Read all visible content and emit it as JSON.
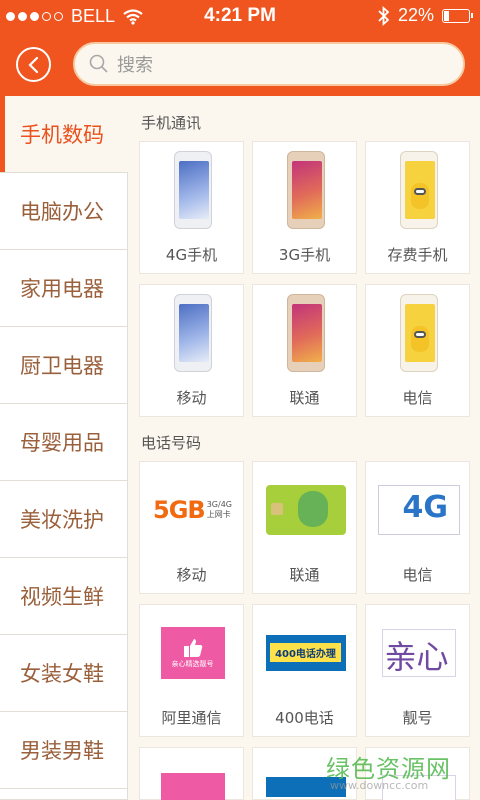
{
  "status_bar": {
    "carrier": "BELL",
    "time": "4:21 PM",
    "battery_text": "22%",
    "battery_level": 0.22,
    "signal_bars": 3
  },
  "header": {
    "search_placeholder": "搜索"
  },
  "sidebar": {
    "items": [
      {
        "label": "手机数码"
      },
      {
        "label": "电脑办公"
      },
      {
        "label": "家用电器"
      },
      {
        "label": "厨卫电器"
      },
      {
        "label": "母婴用品"
      },
      {
        "label": "美妆洗护"
      },
      {
        "label": "视频生鲜"
      },
      {
        "label": "女装女鞋"
      },
      {
        "label": "男装男鞋"
      }
    ]
  },
  "sections": [
    {
      "title": "手机通讯",
      "items": [
        {
          "label": "4G手机"
        },
        {
          "label": "3G手机"
        },
        {
          "label": "存费手机"
        },
        {
          "label": "移动"
        },
        {
          "label": "联通"
        },
        {
          "label": "电信"
        }
      ]
    },
    {
      "title": "电话号码",
      "items": [
        {
          "label": "移动"
        },
        {
          "label": "联通"
        },
        {
          "label": "电信"
        },
        {
          "label": "阿里通信"
        },
        {
          "label": "400电话"
        },
        {
          "label": "靓号"
        }
      ]
    }
  ],
  "ads": {
    "fiveg_main": "5GB",
    "fiveg_top": "3G/4G",
    "fiveg_sub": "上网卡",
    "fourg": "4G",
    "pink_text": "亲心精选靓号",
    "blue_text": "400电话办理",
    "xin_text": "亲心"
  },
  "watermark": {
    "text": "绿色资源网",
    "url": "www.downcc.com"
  },
  "colors": {
    "brand": "#f0551f",
    "background": "#fbf6ee",
    "sidebar_text": "#9a5f3b"
  }
}
